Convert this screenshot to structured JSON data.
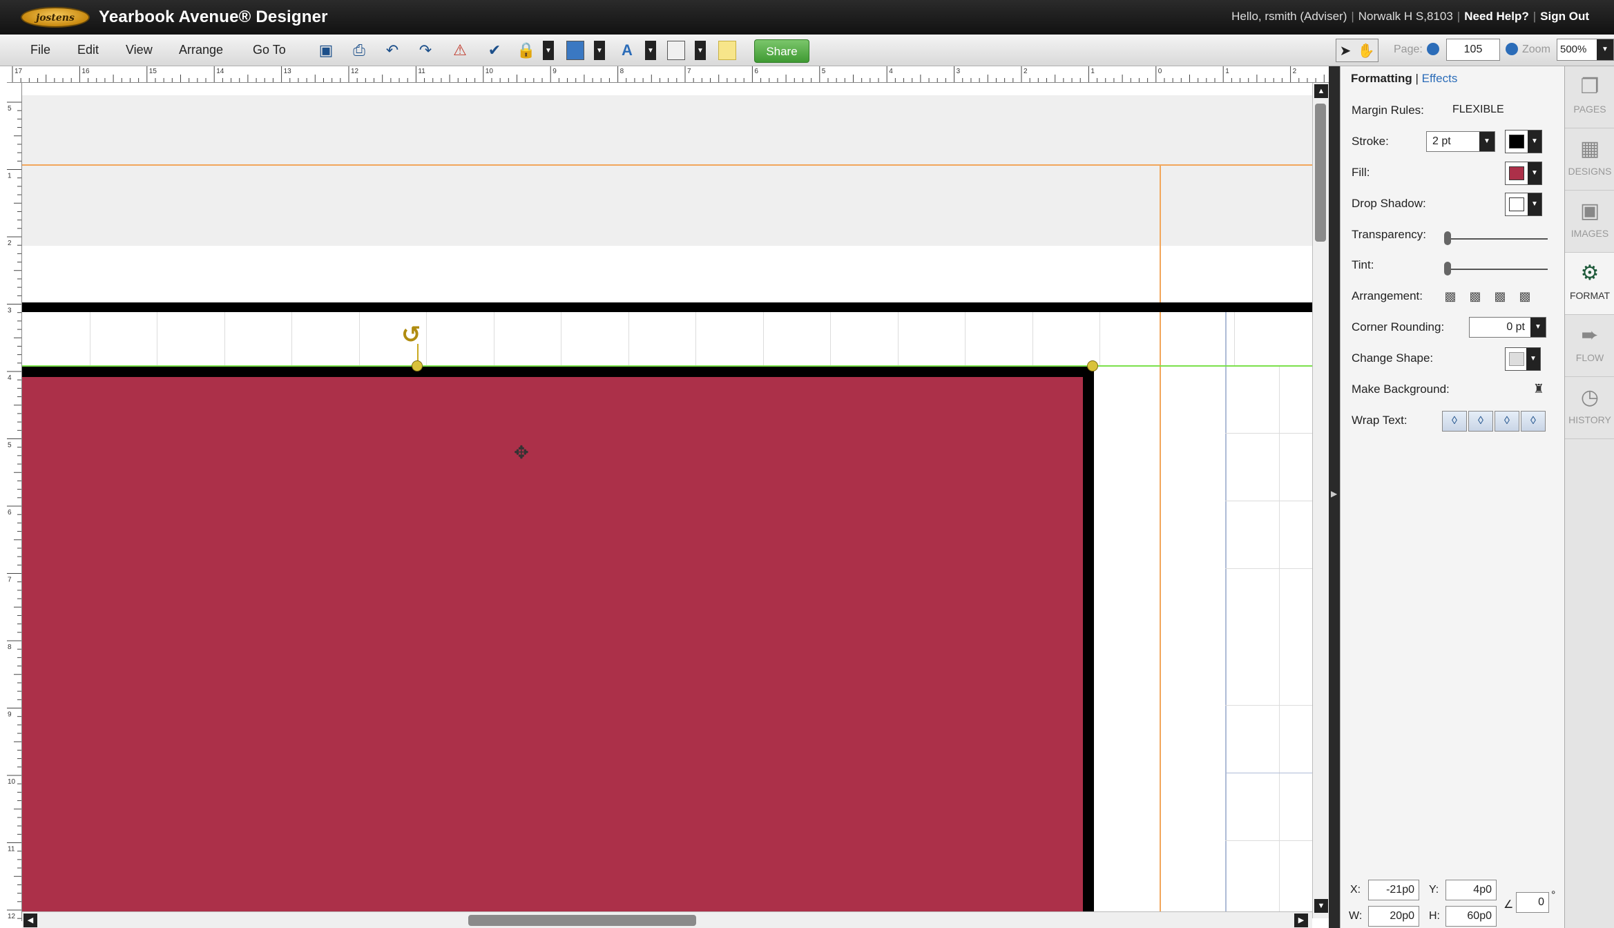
{
  "titlebar": {
    "logo_text": "jostens",
    "app_title": "Yearbook Avenue® Designer",
    "greeting": "Hello, rsmith (Adviser)",
    "school": "Norwalk H S,8103",
    "help": "Need Help?",
    "signout": "Sign Out"
  },
  "menu": {
    "items": [
      "File",
      "Edit",
      "View",
      "Arrange",
      "Go To"
    ]
  },
  "toolbar": {
    "share_label": "Share",
    "page_label": "Page:",
    "page_value": "105",
    "zoom_label": "Zoom",
    "zoom_value": "500%"
  },
  "ruler": {
    "h_numbers": [
      "17",
      "16",
      "15",
      "14",
      "13",
      "12",
      "11",
      "10",
      "9",
      "8",
      "7",
      "6",
      "5",
      "4",
      "3",
      "2",
      "1",
      "0",
      "1",
      "2"
    ],
    "v_numbers": [
      "5",
      "1",
      "2",
      "3",
      "4",
      "5",
      "6",
      "7",
      "8",
      "9",
      "10",
      "11",
      "12"
    ]
  },
  "panel": {
    "tab_formatting": "Formatting",
    "tab_sep": "|",
    "tab_effects": "Effects",
    "margin_rules_label": "Margin Rules:",
    "margin_rules_value": "FLEXIBLE",
    "stroke_label": "Stroke:",
    "stroke_value": "2 pt",
    "fill_label": "Fill:",
    "drop_shadow_label": "Drop Shadow:",
    "transparency_label": "Transparency:",
    "transparency_value": 0,
    "tint_label": "Tint:",
    "tint_value": 0,
    "arrangement_label": "Arrangement:",
    "corner_rounding_label": "Corner Rounding:",
    "corner_rounding_value": "0 pt",
    "change_shape_label": "Change Shape:",
    "make_background_label": "Make Background:",
    "wrap_text_label": "Wrap Text:",
    "x_label": "X:",
    "x_value": "-21p0",
    "y_label": "Y:",
    "y_value": "4p0",
    "w_label": "W:",
    "w_value": "20p0",
    "h_label": "H:",
    "h_value": "60p0",
    "angle_value": "0",
    "angle_unit": "°"
  },
  "rail": {
    "items": [
      {
        "label": "PAGES",
        "icon": "pages-icon"
      },
      {
        "label": "DESIGNS",
        "icon": "designs-icon"
      },
      {
        "label": "IMAGES",
        "icon": "images-icon"
      },
      {
        "label": "FORMAT",
        "icon": "format-icon"
      },
      {
        "label": "FLOW",
        "icon": "flow-icon"
      },
      {
        "label": "HISTORY",
        "icon": "history-icon"
      }
    ]
  },
  "colors": {
    "shape_fill": "#ac3049",
    "stroke": "#000000",
    "guide_orange": "#f2a65a",
    "guide_green": "#7be04a",
    "share_green": "#4aa63c",
    "link_blue": "#2b6cb8"
  }
}
